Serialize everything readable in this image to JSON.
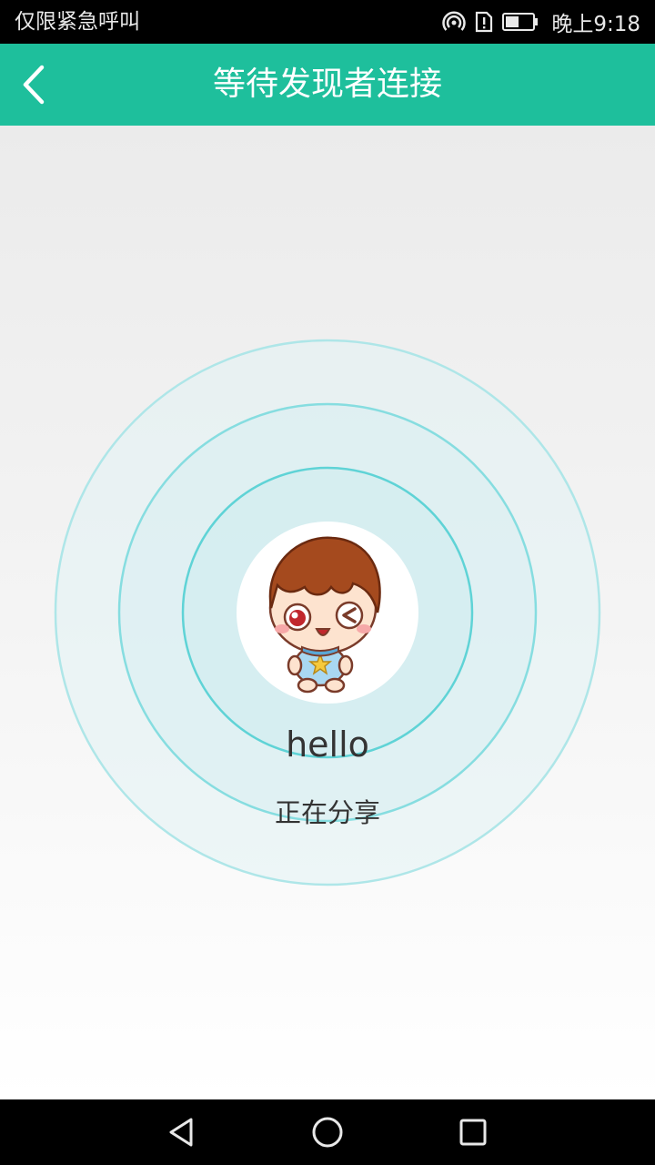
{
  "status_bar": {
    "carrier": "仅限紧急呼叫",
    "time": "晚上9:18",
    "icons": [
      "hotspot-icon",
      "sim-alert-icon",
      "battery-icon"
    ]
  },
  "app_bar": {
    "title": "等待发现者连接",
    "back_icon": "chevron-left-icon"
  },
  "main": {
    "user_name": "hello",
    "share_status": "正在分享",
    "avatar": "cartoon-boy-avatar"
  },
  "nav_bar": {
    "icons": [
      "back-triangle-icon",
      "home-circle-icon",
      "recents-square-icon"
    ]
  },
  "colors": {
    "accent": "#1ebf9c",
    "ring": "#5fd3d6"
  }
}
